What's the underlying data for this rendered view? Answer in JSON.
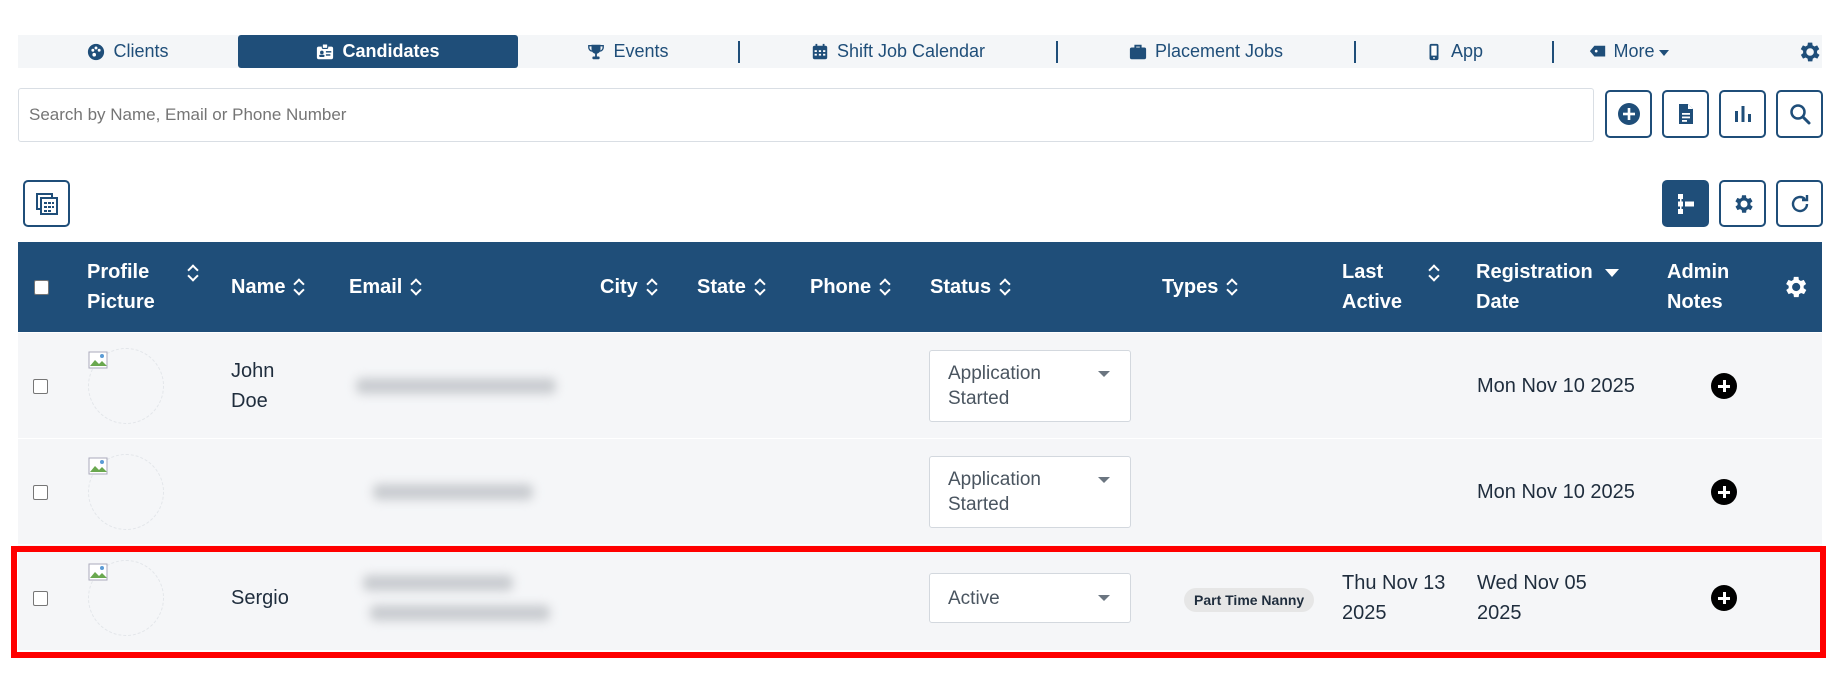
{
  "nav": {
    "tabs": [
      {
        "label": "Clients",
        "icon": "palette-icon"
      },
      {
        "label": "Candidates",
        "icon": "id-badge-icon",
        "active": true
      },
      {
        "label": "Events",
        "icon": "trophy-icon"
      },
      {
        "label": "Shift Job Calendar",
        "icon": "calendar-icon"
      },
      {
        "label": "Placement Jobs",
        "icon": "briefcase-icon"
      },
      {
        "label": "App",
        "icon": "mobile-icon"
      },
      {
        "label": "More",
        "icon": "tag-icon"
      }
    ]
  },
  "search": {
    "placeholder": "Search by Name, Email or Phone Number"
  },
  "table": {
    "headers": {
      "profile_picture": [
        "Profile",
        "Picture"
      ],
      "name": "Name",
      "email": "Email",
      "city": "City",
      "state": "State",
      "phone": "Phone",
      "status": "Status",
      "types": "Types",
      "last_active": [
        "Last",
        "Active"
      ],
      "registration_date": [
        "Registration",
        "Date"
      ],
      "admin_notes": [
        "Admin",
        "Notes"
      ]
    },
    "rows": [
      {
        "name_lines": [
          "John",
          "Doe"
        ],
        "status_lines": [
          "Application",
          "Started"
        ],
        "types": "",
        "last_active_lines": [
          "",
          ""
        ],
        "registration_lines": [
          "Mon Nov 10 2025",
          ""
        ]
      },
      {
        "name_lines": [
          "",
          ""
        ],
        "status_lines": [
          "Application",
          "Started"
        ],
        "types": "",
        "last_active_lines": [
          "",
          ""
        ],
        "registration_lines": [
          "Mon Nov 10 2025",
          ""
        ]
      },
      {
        "name_lines": [
          "Sergio",
          ""
        ],
        "status_lines": [
          "Active",
          ""
        ],
        "types": "Part Time Nanny",
        "last_active_lines": [
          "Thu Nov 13",
          "2025"
        ],
        "registration_lines": [
          "Wed Nov 05",
          "2025"
        ]
      }
    ]
  },
  "colors": {
    "primary": "#1f4e79",
    "row_bg": "#f5f6f8",
    "highlight": "#ff0000"
  }
}
